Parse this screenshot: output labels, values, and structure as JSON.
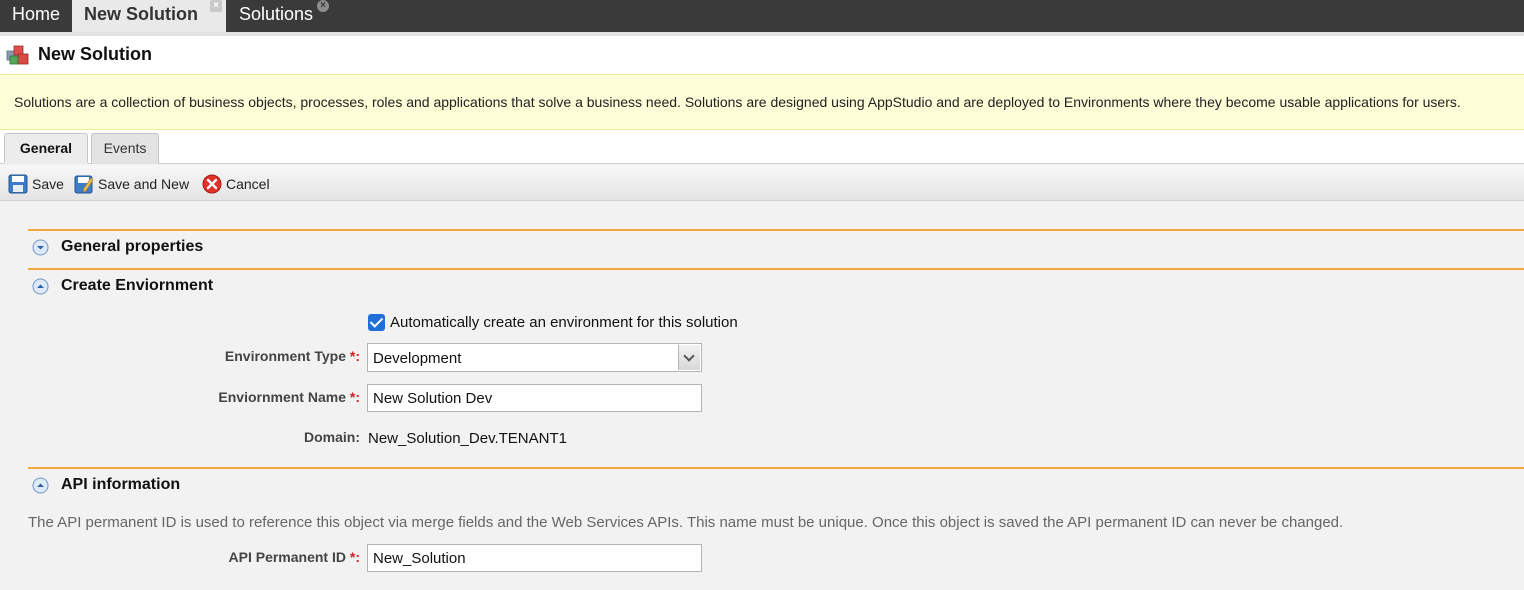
{
  "top_tabs": {
    "home": "Home",
    "new_solution": "New Solution",
    "solutions": "Solutions",
    "close_glyph": "×"
  },
  "header": {
    "title": "New Solution"
  },
  "banner": {
    "text": "Solutions are a collection of business objects, processes, roles and applications that solve a business need. Solutions are designed using AppStudio and are deployed to Environments where they become usable applications for users."
  },
  "form_tabs": {
    "general": "General",
    "events": "Events"
  },
  "toolbar": {
    "save": "Save",
    "save_and_new": "Save and New",
    "cancel": "Cancel"
  },
  "sections": {
    "general_properties": "General properties",
    "create_environment": "Create Enviornment",
    "api_information": "API information"
  },
  "create_env": {
    "auto_create_label": "Automatically create an environment for this solution",
    "auto_create_checked": true,
    "environment_type_label": "Environment Type",
    "environment_type_value": "Development",
    "environment_name_label": "Enviornment Name",
    "environment_name_value": "New Solution Dev",
    "domain_label": "Domain:",
    "domain_value": "New_Solution_Dev.TENANT1"
  },
  "api": {
    "description": "The API permanent ID is used to reference this object via merge fields and the Web Services APIs. This name must be unique. Once this object is saved the API permanent ID can never be changed.",
    "permanent_id_label": "API Permanent ID",
    "permanent_id_value": "New_Solution"
  },
  "required_marker": "*:",
  "colors": {
    "section_border": "#f2a93b",
    "banner_bg": "#fdfdd8",
    "checkbox": "#1f6fd8",
    "required": "#d21e1e"
  },
  "icons": {
    "header": "solution-cubes-icon",
    "save": "floppy-disk-icon",
    "save_and_new": "floppy-pencil-icon",
    "cancel": "red-x-circle-icon",
    "section_collapsed": "chevron-down-circle-icon",
    "section_expanded": "chevron-up-circle-icon"
  }
}
